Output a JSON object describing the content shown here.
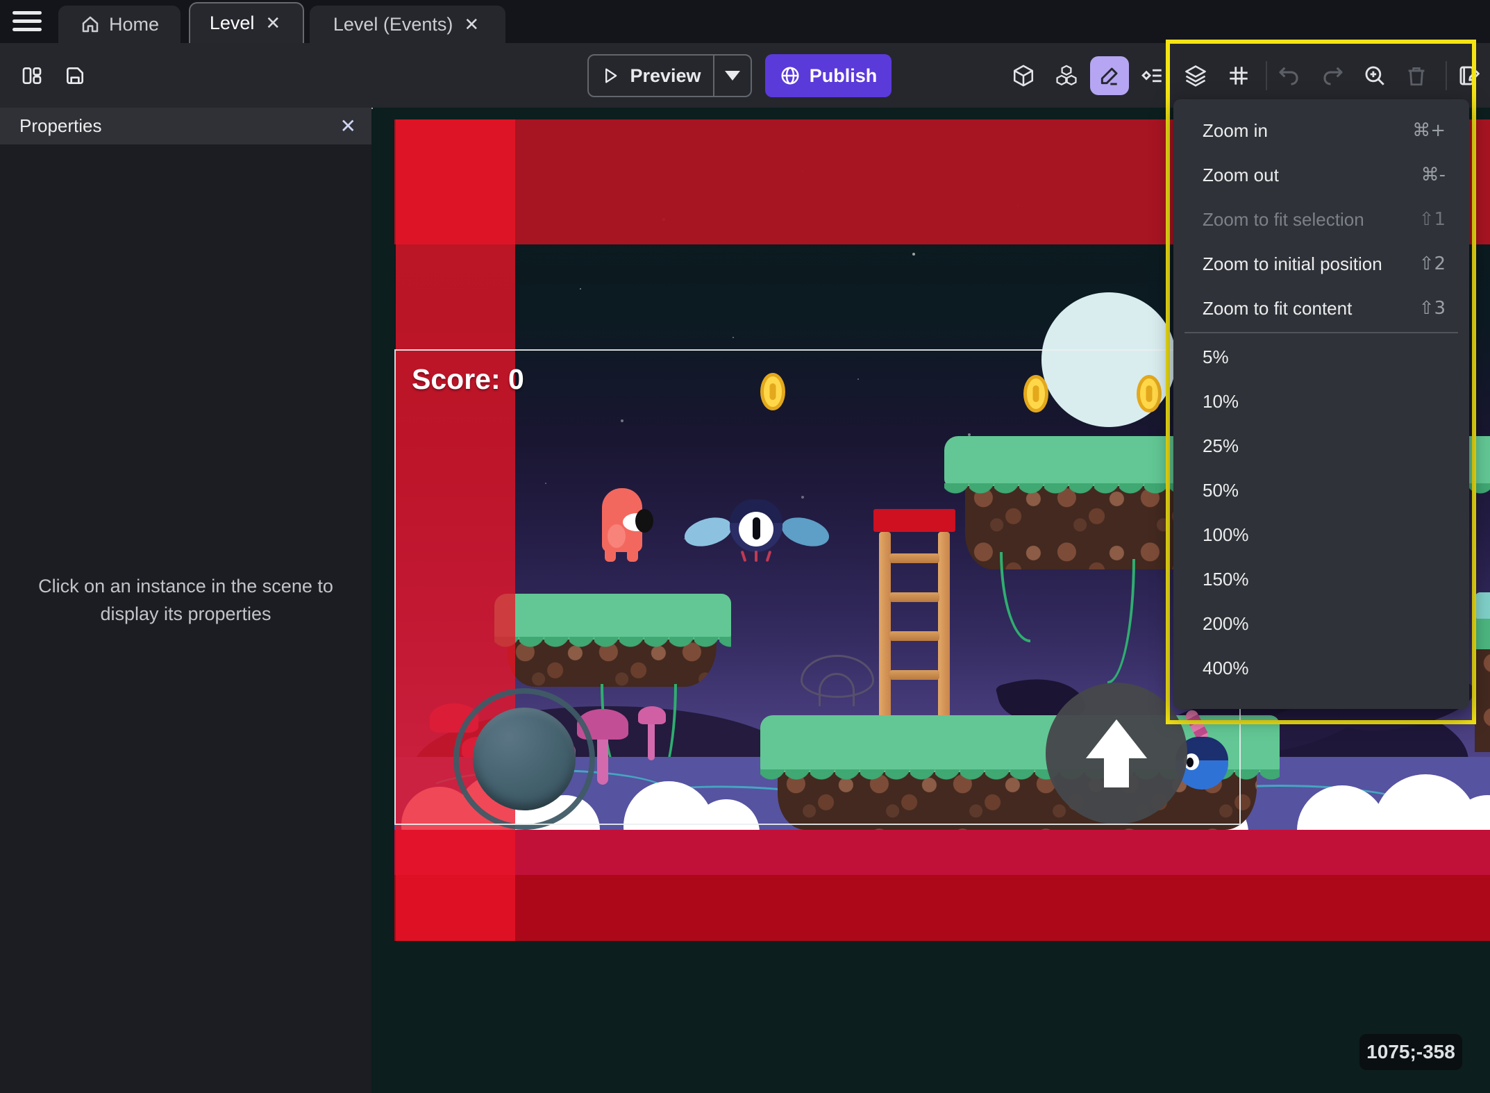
{
  "tabs": {
    "home": "Home",
    "level": "Level",
    "level_events": "Level (Events)"
  },
  "toolbar": {
    "preview": "Preview",
    "publish": "Publish"
  },
  "properties_panel": {
    "title": "Properties",
    "hint": "Click on an instance in the scene to display its properties"
  },
  "game": {
    "score_text": "Score: 0",
    "coordinates": "1075;-358"
  },
  "zoom_menu": {
    "actions": [
      {
        "label": "Zoom in",
        "shortcut": "⌘+",
        "enabled": true
      },
      {
        "label": "Zoom out",
        "shortcut": "⌘-",
        "enabled": true
      },
      {
        "label": "Zoom to fit selection",
        "shortcut": "⇧1",
        "enabled": false
      },
      {
        "label": "Zoom to initial position",
        "shortcut": "⇧2",
        "enabled": true
      },
      {
        "label": "Zoom to fit content",
        "shortcut": "⇧3",
        "enabled": true
      }
    ],
    "levels": [
      "5%",
      "10%",
      "25%",
      "50%",
      "100%",
      "150%",
      "200%",
      "400%"
    ]
  },
  "colors": {
    "accent_purple": "#5b3ada",
    "active_tool_bg": "#b5a5f2",
    "selection_yellow": "#f4e414",
    "danger_red_zone": "#d01540",
    "coin_gold": "#ffd84a"
  }
}
